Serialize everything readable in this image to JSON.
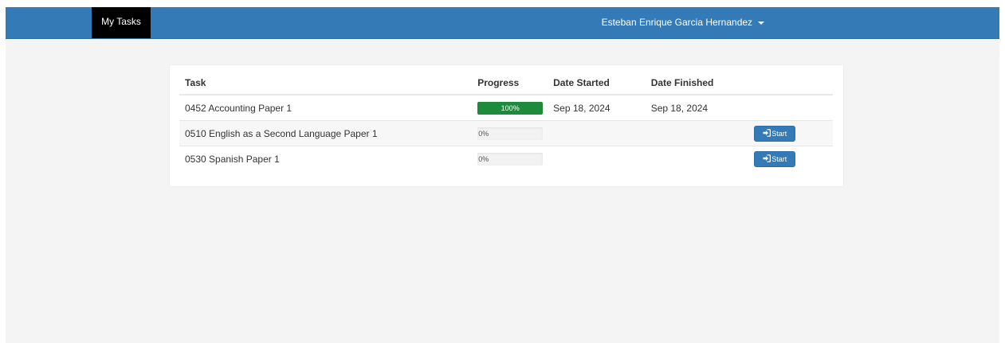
{
  "navbar": {
    "brand": "My Tasks",
    "user_name": "Esteban Enrique Garcia Hernandez"
  },
  "table": {
    "headers": {
      "task": "Task",
      "progress": "Progress",
      "date_started": "Date Started",
      "date_finished": "Date Finished"
    },
    "rows": [
      {
        "task": "0452 Accounting Paper 1",
        "progress_label": "100%",
        "progress_value": 100,
        "date_started": "Sep 18, 2024",
        "date_finished": "Sep 18, 2024",
        "action_label": ""
      },
      {
        "task": "0510 English as a Second Language Paper 1",
        "progress_label": "0%",
        "progress_value": 0,
        "date_started": "",
        "date_finished": "",
        "action_label": "Start"
      },
      {
        "task": "0530 Spanish Paper 1",
        "progress_label": "0%",
        "progress_value": 0,
        "date_started": "",
        "date_finished": "",
        "action_label": "Start"
      }
    ]
  },
  "icons": {
    "start_button_icon": "login-icon",
    "user_menu_icon": "caret-down-icon"
  },
  "colors": {
    "navbar": "#337ab7",
    "brand_background": "#000000",
    "progress_complete": "#1e8a3c",
    "button_primary": "#337ab7",
    "page_background": "#f4f4f4"
  }
}
